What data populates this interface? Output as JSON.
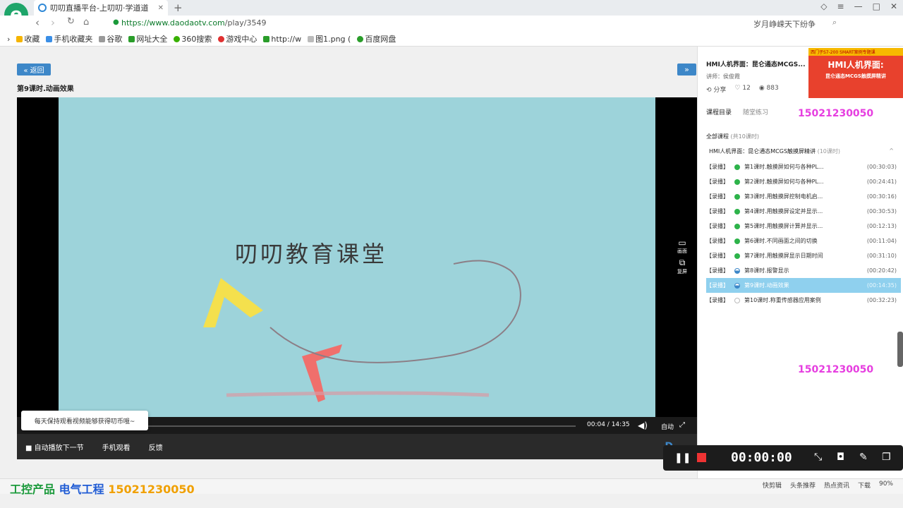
{
  "browser": {
    "tab_title": "叨叨直播平台-上叨叨·学道道",
    "url_host": "https://www.daodaotv.com",
    "url_path": "/play/3549",
    "search_text": "岁月峥嵘天下纷争",
    "new_tab": "+"
  },
  "bookmarks": [
    {
      "label": "收藏",
      "color": "#f5b400"
    },
    {
      "label": "手机收藏夹",
      "color": "#3a8ee6"
    },
    {
      "label": "谷歌",
      "color": "#999999"
    },
    {
      "label": "网址大全",
      "color": "#2a9d2a"
    },
    {
      "label": "360搜索",
      "color": "#38b000"
    },
    {
      "label": "游戏中心",
      "color": "#e03030"
    },
    {
      "label": "http://w",
      "color": "#2a9d2a"
    },
    {
      "label": "图1.png (",
      "color": "#999999"
    },
    {
      "label": "百度网盘",
      "color": "#2a9d2a"
    }
  ],
  "page": {
    "back_label": "« 返回",
    "next_label": "»",
    "lesson_title": "第9课时.动画效果"
  },
  "video": {
    "overlay_text": "叨叨教育课堂",
    "side_screen": "画面",
    "side_copy": "复屏"
  },
  "controls": {
    "current": "00:04",
    "total": "14:35",
    "progress": 0.005,
    "quality": "自动",
    "autoplay": "自动播放下一节",
    "mobile": "手机观看",
    "feedback": "反馈"
  },
  "toast": "每天保持观看视频能够获得叨币哦~",
  "course": {
    "name": "HMI人机界面：昆仑通态MCGS...",
    "teacher": "讲师：侯俊霞",
    "share": "分享",
    "likes": "12",
    "views": "883",
    "banner_top": "西门子S7-200 SMART案例专题课",
    "banner_title": "HMI人机界面:",
    "banner_sub": "昆仑通态MCGS触摸屏精讲"
  },
  "sidebar": {
    "tab_catalog": "课程目录",
    "tab_practice": "随堂练习",
    "phone_top": "15021230050",
    "phone_bottom": "15021230050",
    "all_label": "全部课程",
    "all_count": "(共10课时)",
    "group_title": "HMI人机界面：昆仑通态MCGS触摸屏精讲",
    "group_count": "(10课时)"
  },
  "lessons": [
    {
      "tag": "【录播】",
      "title": "第1课时.触摸屏如何与各种PL...",
      "duration": "(00:30:03)",
      "status": "done"
    },
    {
      "tag": "【录播】",
      "title": "第2课时.触摸屏如何与各种PL...",
      "duration": "(00:24:41)",
      "status": "done"
    },
    {
      "tag": "【录播】",
      "title": "第3课时.用触摸屏控制电机启...",
      "duration": "(00:30:16)",
      "status": "done"
    },
    {
      "tag": "【录播】",
      "title": "第4课时.用触摸屏设定并显示...",
      "duration": "(00:30:53)",
      "status": "done"
    },
    {
      "tag": "【录播】",
      "title": "第5课时.用触摸屏计算并显示...",
      "duration": "(00:12:13)",
      "status": "done"
    },
    {
      "tag": "【录播】",
      "title": "第6课时.不同画面之间的切换",
      "duration": "(00:11:04)",
      "status": "done"
    },
    {
      "tag": "【录播】",
      "title": "第7课时.用触摸屏显示日期时间",
      "duration": "(00:31:10)",
      "status": "done"
    },
    {
      "tag": "【录播】",
      "title": "第8课时.报警显示",
      "duration": "(00:20:42)",
      "status": "partial"
    },
    {
      "tag": "【录播】",
      "title": "第9课时.动画效果",
      "duration": "(00:14:35)",
      "status": "active"
    },
    {
      "tag": "【录播】",
      "title": "第10课时.称重传感器应用案例",
      "duration": "(00:32:23)",
      "status": "none"
    }
  ],
  "recorder": {
    "time": "00:00:00"
  },
  "status": {
    "promo_a": "工控产品",
    "promo_b": "电气工程",
    "promo_c": "15021230050",
    "items": [
      "快剪辑",
      "头条推荐",
      "热点资讯",
      "下载",
      "90%"
    ]
  },
  "colors": {
    "accent": "#3d87c8",
    "done": "#2db34a",
    "active_row": "#8fd0ee",
    "phone": "#e63ee0"
  }
}
